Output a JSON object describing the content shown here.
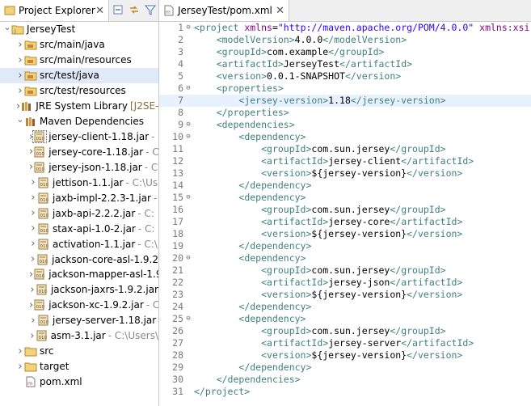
{
  "project_explorer": {
    "title": "Project Explorer",
    "close_glyph": "✕",
    "tree": [
      {
        "indent": 0,
        "twisty": "open",
        "icon": "project-folder-icon",
        "label": "JerseyTest",
        "decor": "",
        "selected": false
      },
      {
        "indent": 1,
        "twisty": "closed",
        "icon": "source-folder-icon",
        "label": "src/main/java",
        "decor": "",
        "selected": false
      },
      {
        "indent": 1,
        "twisty": "closed",
        "icon": "source-folder-icon",
        "label": "src/main/resources",
        "decor": "",
        "selected": false
      },
      {
        "indent": 1,
        "twisty": "closed",
        "icon": "source-folder-icon",
        "label": "src/test/java",
        "decor": "",
        "selected": true
      },
      {
        "indent": 1,
        "twisty": "closed",
        "icon": "source-folder-icon",
        "label": "src/test/resources",
        "decor": "",
        "selected": false
      },
      {
        "indent": 1,
        "twisty": "closed",
        "icon": "library-icon",
        "label": "JRE System Library",
        "decor": "[J2SE-1",
        "selected": false
      },
      {
        "indent": 1,
        "twisty": "open",
        "icon": "library-icon",
        "label": "Maven Dependencies",
        "decor": "",
        "selected": false
      },
      {
        "indent": 2,
        "twisty": "closed",
        "icon": "jar-icon",
        "label": "jersey-client-1.18.jar",
        "decor": "- C",
        "selected": false,
        "boxed": true
      },
      {
        "indent": 2,
        "twisty": "closed",
        "icon": "jar-icon",
        "label": "jersey-core-1.18.jar",
        "decor": "- C:",
        "selected": false
      },
      {
        "indent": 2,
        "twisty": "closed",
        "icon": "jar-icon",
        "label": "jersey-json-1.18.jar",
        "decor": "- C:",
        "selected": false
      },
      {
        "indent": 2,
        "twisty": "closed",
        "icon": "jar-icon",
        "label": "jettison-1.1.jar",
        "decor": "- C:\\Us",
        "selected": false
      },
      {
        "indent": 2,
        "twisty": "closed",
        "icon": "jar-icon",
        "label": "jaxb-impl-2.2.3-1.jar",
        "decor": "-",
        "selected": false
      },
      {
        "indent": 2,
        "twisty": "closed",
        "icon": "jar-icon",
        "label": "jaxb-api-2.2.2.jar",
        "decor": "- C:",
        "selected": false
      },
      {
        "indent": 2,
        "twisty": "closed",
        "icon": "jar-icon",
        "label": "stax-api-1.0-2.jar",
        "decor": "- C:",
        "selected": false
      },
      {
        "indent": 2,
        "twisty": "closed",
        "icon": "jar-icon",
        "label": "activation-1.1.jar",
        "decor": "- C:\\",
        "selected": false
      },
      {
        "indent": 2,
        "twisty": "closed",
        "icon": "jar-icon",
        "label": "jackson-core-asl-1.9.2",
        "decor": "",
        "selected": false
      },
      {
        "indent": 2,
        "twisty": "closed",
        "icon": "jar-icon",
        "label": "jackson-mapper-asl-1.9",
        "decor": "",
        "selected": false
      },
      {
        "indent": 2,
        "twisty": "closed",
        "icon": "jar-icon",
        "label": "jackson-jaxrs-1.9.2.jar",
        "decor": "",
        "selected": false
      },
      {
        "indent": 2,
        "twisty": "closed",
        "icon": "jar-icon",
        "label": "jackson-xc-1.9.2.jar",
        "decor": "- C",
        "selected": false
      },
      {
        "indent": 2,
        "twisty": "closed",
        "icon": "jar-icon",
        "label": "jersey-server-1.18.jar",
        "decor": "",
        "selected": false
      },
      {
        "indent": 2,
        "twisty": "closed",
        "icon": "jar-icon",
        "label": "asm-3.1.jar",
        "decor": "- C:\\Users\\",
        "selected": false
      },
      {
        "indent": 1,
        "twisty": "closed",
        "icon": "folder-icon",
        "label": "src",
        "decor": "",
        "selected": false
      },
      {
        "indent": 1,
        "twisty": "closed",
        "icon": "folder-icon",
        "label": "target",
        "decor": "",
        "selected": false
      },
      {
        "indent": 1,
        "twisty": "none",
        "icon": "xml-file-icon",
        "label": "pom.xml",
        "decor": "",
        "selected": false
      }
    ]
  },
  "editor": {
    "tab_title": "JerseyTest/pom.xml",
    "close_glyph": "✕",
    "highlight_line": 7,
    "lines": [
      {
        "n": 1,
        "fold": "⊖",
        "indent": 0,
        "parts": [
          [
            "tag",
            "<project "
          ],
          [
            "attr",
            "xmlns"
          ],
          [
            "txt",
            "="
          ],
          [
            "val",
            "\"http://maven.apache.org/POM/4.0.0\""
          ],
          [
            "txt",
            " "
          ],
          [
            "attr",
            "xmlns:xsi"
          ]
        ]
      },
      {
        "n": 2,
        "fold": "",
        "indent": 1,
        "parts": [
          [
            "tag",
            "<modelVersion>"
          ],
          [
            "txt",
            "4.0.0"
          ],
          [
            "tag",
            "</modelVersion>"
          ]
        ]
      },
      {
        "n": 3,
        "fold": "",
        "indent": 1,
        "parts": [
          [
            "tag",
            "<groupId>"
          ],
          [
            "txt",
            "com.example"
          ],
          [
            "tag",
            "</groupId>"
          ]
        ]
      },
      {
        "n": 4,
        "fold": "",
        "indent": 1,
        "parts": [
          [
            "tag",
            "<artifactId>"
          ],
          [
            "txt",
            "JerseyTest"
          ],
          [
            "tag",
            "</artifactId>"
          ]
        ]
      },
      {
        "n": 5,
        "fold": "",
        "indent": 1,
        "parts": [
          [
            "tag",
            "<version>"
          ],
          [
            "txt",
            "0.0.1-SNAPSHOT"
          ],
          [
            "tag",
            "</version>"
          ]
        ]
      },
      {
        "n": 6,
        "fold": "⊖",
        "indent": 1,
        "parts": [
          [
            "tag",
            "<properties>"
          ]
        ]
      },
      {
        "n": 7,
        "fold": "",
        "indent": 2,
        "parts": [
          [
            "tag",
            "<jersey-version>"
          ],
          [
            "txt",
            "1.18"
          ],
          [
            "tag",
            "</jersey-version>"
          ]
        ]
      },
      {
        "n": 8,
        "fold": "",
        "indent": 1,
        "parts": [
          [
            "tag",
            "</properties>"
          ]
        ]
      },
      {
        "n": 9,
        "fold": "⊖",
        "indent": 1,
        "parts": [
          [
            "tag",
            "<dependencies>"
          ]
        ]
      },
      {
        "n": 10,
        "fold": "⊖",
        "indent": 2,
        "parts": [
          [
            "tag",
            "<dependency>"
          ]
        ]
      },
      {
        "n": 11,
        "fold": "",
        "indent": 3,
        "parts": [
          [
            "tag",
            "<groupId>"
          ],
          [
            "txt",
            "com.sun.jersey"
          ],
          [
            "tag",
            "</groupId>"
          ]
        ]
      },
      {
        "n": 12,
        "fold": "",
        "indent": 3,
        "parts": [
          [
            "tag",
            "<artifactId>"
          ],
          [
            "txt",
            "jersey-client"
          ],
          [
            "tag",
            "</artifactId>"
          ]
        ]
      },
      {
        "n": 13,
        "fold": "",
        "indent": 3,
        "parts": [
          [
            "tag",
            "<version>"
          ],
          [
            "txt",
            "${jersey-version}"
          ],
          [
            "tag",
            "</version>"
          ]
        ]
      },
      {
        "n": 14,
        "fold": "",
        "indent": 2,
        "parts": [
          [
            "tag",
            "</dependency>"
          ]
        ]
      },
      {
        "n": 15,
        "fold": "⊖",
        "indent": 2,
        "parts": [
          [
            "tag",
            "<dependency>"
          ]
        ]
      },
      {
        "n": 16,
        "fold": "",
        "indent": 3,
        "parts": [
          [
            "tag",
            "<groupId>"
          ],
          [
            "txt",
            "com.sun.jersey"
          ],
          [
            "tag",
            "</groupId>"
          ]
        ]
      },
      {
        "n": 17,
        "fold": "",
        "indent": 3,
        "parts": [
          [
            "tag",
            "<artifactId>"
          ],
          [
            "txt",
            "jersey-core"
          ],
          [
            "tag",
            "</artifactId>"
          ]
        ]
      },
      {
        "n": 18,
        "fold": "",
        "indent": 3,
        "parts": [
          [
            "tag",
            "<version>"
          ],
          [
            "txt",
            "${jersey-version}"
          ],
          [
            "tag",
            "</version>"
          ]
        ]
      },
      {
        "n": 19,
        "fold": "",
        "indent": 2,
        "parts": [
          [
            "tag",
            "</dependency>"
          ]
        ]
      },
      {
        "n": 20,
        "fold": "⊖",
        "indent": 2,
        "parts": [
          [
            "tag",
            "<dependency>"
          ]
        ]
      },
      {
        "n": 21,
        "fold": "",
        "indent": 3,
        "parts": [
          [
            "tag",
            "<groupId>"
          ],
          [
            "txt",
            "com.sun.jersey"
          ],
          [
            "tag",
            "</groupId>"
          ]
        ]
      },
      {
        "n": 22,
        "fold": "",
        "indent": 3,
        "parts": [
          [
            "tag",
            "<artifactId>"
          ],
          [
            "txt",
            "jersey-json"
          ],
          [
            "tag",
            "</artifactId>"
          ]
        ]
      },
      {
        "n": 23,
        "fold": "",
        "indent": 3,
        "parts": [
          [
            "tag",
            "<version>"
          ],
          [
            "txt",
            "${jersey-version}"
          ],
          [
            "tag",
            "</version>"
          ]
        ]
      },
      {
        "n": 24,
        "fold": "",
        "indent": 2,
        "parts": [
          [
            "tag",
            "</dependency>"
          ]
        ]
      },
      {
        "n": 25,
        "fold": "⊖",
        "indent": 2,
        "parts": [
          [
            "tag",
            "<dependency>"
          ]
        ]
      },
      {
        "n": 26,
        "fold": "",
        "indent": 3,
        "parts": [
          [
            "tag",
            "<groupId>"
          ],
          [
            "txt",
            "com.sun.jersey"
          ],
          [
            "tag",
            "</groupId>"
          ]
        ]
      },
      {
        "n": 27,
        "fold": "",
        "indent": 3,
        "parts": [
          [
            "tag",
            "<artifactId>"
          ],
          [
            "txt",
            "jersey-server"
          ],
          [
            "tag",
            "</artifactId>"
          ]
        ]
      },
      {
        "n": 28,
        "fold": "",
        "indent": 3,
        "parts": [
          [
            "tag",
            "<version>"
          ],
          [
            "txt",
            "${jersey-version}"
          ],
          [
            "tag",
            "</version>"
          ]
        ]
      },
      {
        "n": 29,
        "fold": "",
        "indent": 2,
        "parts": [
          [
            "tag",
            "</dependency>"
          ]
        ]
      },
      {
        "n": 30,
        "fold": "",
        "indent": 1,
        "parts": [
          [
            "tag",
            "</dependencies>"
          ]
        ]
      },
      {
        "n": 31,
        "fold": "",
        "indent": 0,
        "parts": [
          [
            "tag",
            "</project>"
          ]
        ]
      }
    ]
  },
  "colors": {
    "selection": "#dfe9f7",
    "line_highlight": "#e8f2fe",
    "xml_tag": "#3f7f7f",
    "xml_attr": "#7f007f",
    "xml_value": "#2a00ff"
  }
}
